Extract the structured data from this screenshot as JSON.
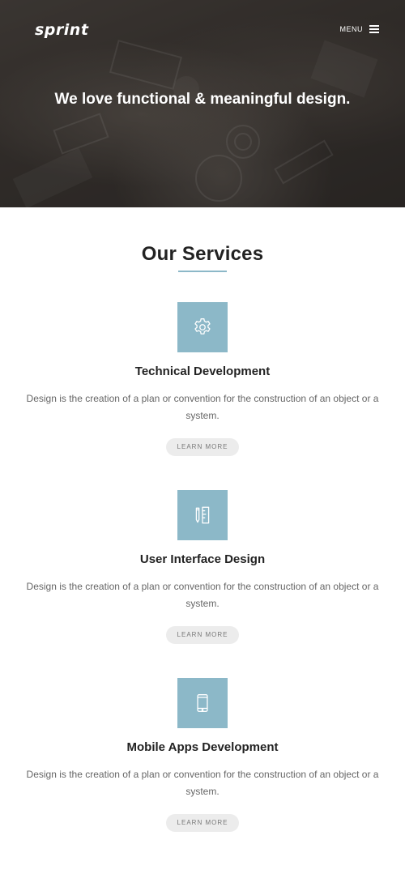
{
  "header": {
    "logo": "sprint",
    "menu_label": "MENU"
  },
  "hero": {
    "tagline": "We love functional & meaningful design."
  },
  "services": {
    "title": "Our Services",
    "items": [
      {
        "icon": "gear-icon",
        "title": "Technical Development",
        "description": "Design is the creation of a plan or convention for the construction of an object or a system.",
        "button": "LEARN MORE"
      },
      {
        "icon": "pencil-ruler-icon",
        "title": "User Interface Design",
        "description": "Design is the creation of a plan or convention for the construction of an object or a system.",
        "button": "LEARN MORE"
      },
      {
        "icon": "mobile-phone-icon",
        "title": "Mobile Apps Development",
        "description": "Design is the creation of a plan or convention for the construction of an object or a system.",
        "button": "LEARN MORE"
      }
    ]
  },
  "colors": {
    "accent": "#8cb8c8",
    "button_bg": "#ececec",
    "hero_dark": "#3b3633"
  }
}
